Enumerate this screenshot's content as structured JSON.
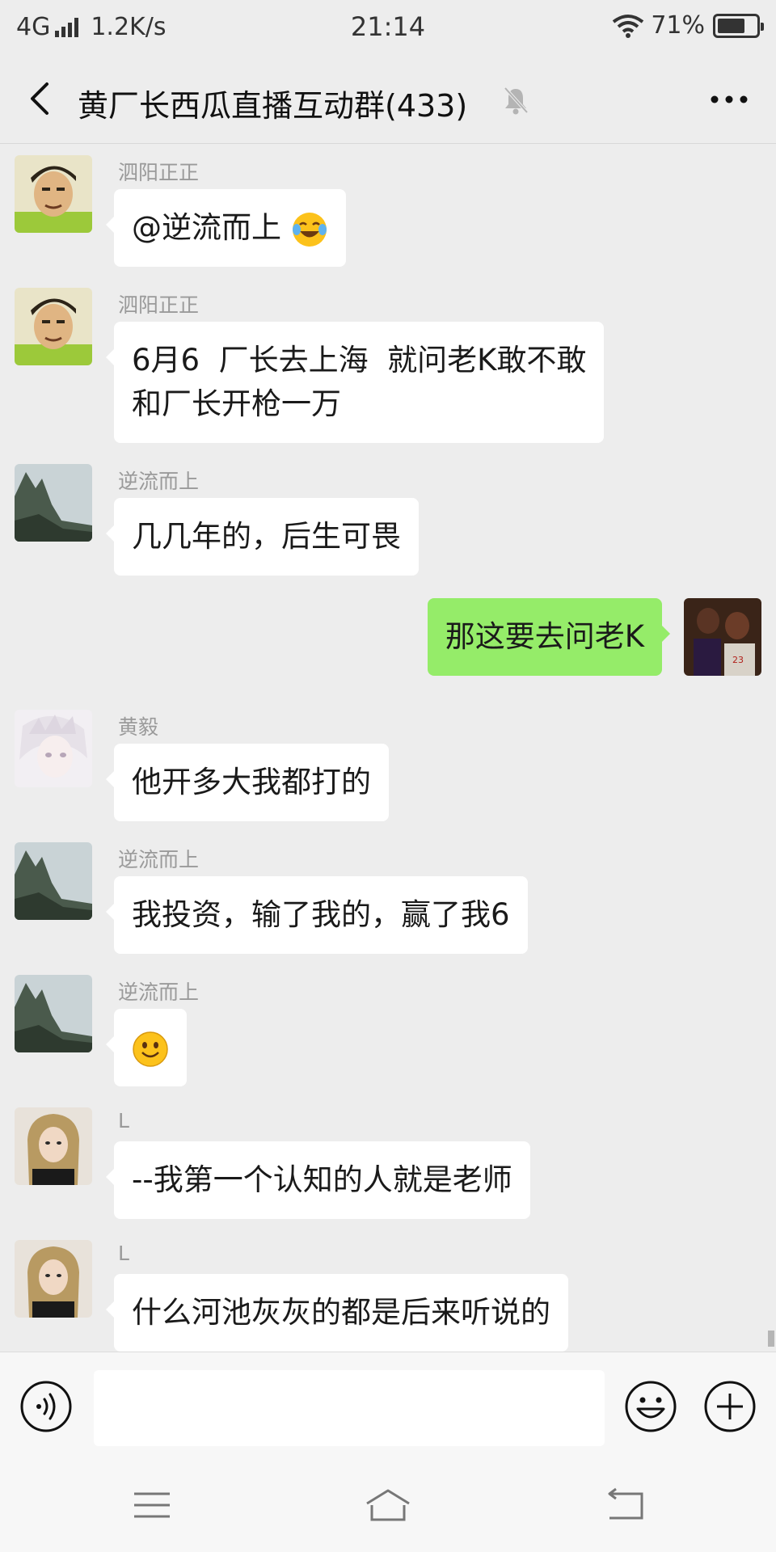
{
  "status_bar": {
    "network": "4G",
    "speed": "1.2K/s",
    "time": "21:14",
    "battery_text": "71%",
    "battery_level": 0.71,
    "icons": [
      "signal-icon",
      "wifi-icon",
      "battery-icon"
    ]
  },
  "header": {
    "title": "黄厂长西瓜直播互动群(433)",
    "icons": [
      "back-arrow-icon",
      "mute-bell-icon",
      "more-dots-icon"
    ]
  },
  "messages": [
    {
      "sender": "泗阳正正",
      "text": "@逆流而上 ",
      "emoji": "laughing-tears-emoji",
      "avatar": "cartoon-boy-avatar",
      "direction": "in"
    },
    {
      "sender": "泗阳正正",
      "lines": [
        "6月6  厂长去上海  就问老K敢不敢",
        "和厂长开枪一万"
      ],
      "avatar": "cartoon-boy-avatar",
      "direction": "in"
    },
    {
      "sender": "逆流而上",
      "text": "几几年的，后生可畏",
      "avatar": "mountain-avatar",
      "direction": "in"
    },
    {
      "sender": "",
      "text": "那这要去问老K",
      "avatar": "basketball-avatar",
      "direction": "out"
    },
    {
      "sender": "黄毅",
      "text": "他开多大我都打的",
      "avatar": "anime-avatar",
      "direction": "in"
    },
    {
      "sender": "逆流而上",
      "text": "我投资，输了我的，赢了我6",
      "avatar": "mountain-avatar",
      "direction": "in"
    },
    {
      "sender": "逆流而上",
      "text": "",
      "emoji": "smile-emoji",
      "avatar": "mountain-avatar",
      "direction": "in"
    },
    {
      "sender": "L",
      "text": "--我第一个认知的人就是老师",
      "avatar": "girl-avatar",
      "direction": "in"
    },
    {
      "sender": "L",
      "text": "什么河池灰灰的都是后来听说的",
      "avatar": "girl-avatar",
      "direction": "in"
    }
  ],
  "input_bar": {
    "placeholder": "",
    "icons": [
      "voice-icon",
      "emoji-icon",
      "plus-icon"
    ]
  },
  "nav_bar": {
    "icons": [
      "menu-icon",
      "home-icon",
      "back-icon"
    ]
  },
  "colors": {
    "background": "#ededed",
    "incoming_bubble": "#ffffff",
    "outgoing_bubble": "#95ec69",
    "sender_name": "#9a9a9a"
  }
}
